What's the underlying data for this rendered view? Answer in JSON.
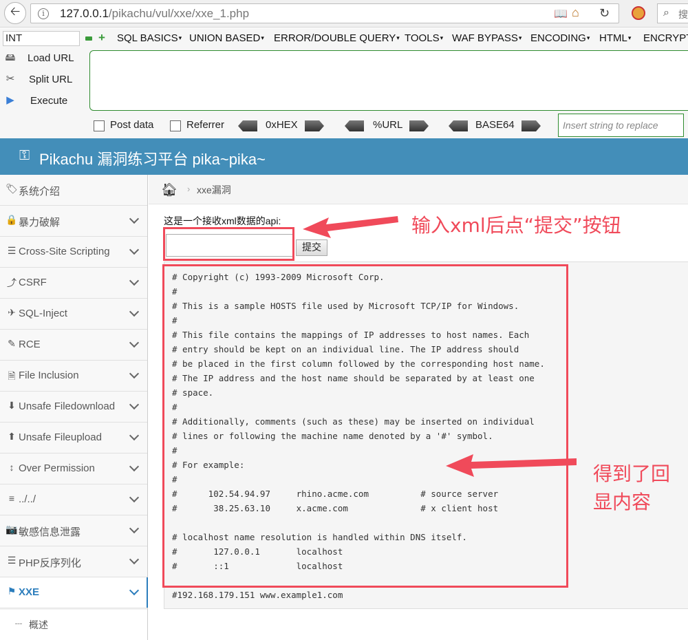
{
  "browser": {
    "url_host": "127.0.0.1",
    "url_path": "/pikachu/vul/xxe/xxe_1.php",
    "search_placeholder": "搜"
  },
  "hackbar": {
    "select_value": "INT",
    "menus": [
      "SQL BASICS",
      "UNION BASED",
      "ERROR/DOUBLE QUERY",
      "TOOLS",
      "WAF BYPASS",
      "ENCODING",
      "HTML",
      "ENCRYPT"
    ],
    "load_url": "Load URL",
    "split_url": "Split URL",
    "execute": "Execute",
    "post_data": "Post data",
    "referrer": "Referrer",
    "hex": "0xHEX",
    "url_enc": "%URL",
    "base64": "BASE64",
    "replace_placeholder": "Insert string to replace"
  },
  "header": {
    "title": "Pikachu 漏洞练习平台 pika~pika~"
  },
  "sidebar": {
    "items": [
      {
        "label": "系统介绍",
        "icon": "tags-icon"
      },
      {
        "label": "暴力破解",
        "icon": "lock-icon"
      },
      {
        "label": "Cross-Site Scripting",
        "icon": "list-icon"
      },
      {
        "label": "CSRF",
        "icon": "share-icon"
      },
      {
        "label": "SQL-Inject",
        "icon": "plane-icon"
      },
      {
        "label": "RCE",
        "icon": "pencil-icon"
      },
      {
        "label": "File Inclusion",
        "icon": "file-icon"
      },
      {
        "label": "Unsafe Filedownload",
        "icon": "download-icon"
      },
      {
        "label": "Unsafe Fileupload",
        "icon": "upload-icon"
      },
      {
        "label": "Over Permission",
        "icon": "text-height-icon"
      },
      {
        "label": "../../",
        "icon": "align-icon"
      },
      {
        "label": "敏感信息泄露",
        "icon": "camera-icon"
      },
      {
        "label": "PHP反序列化",
        "icon": "list-alt-icon"
      },
      {
        "label": "XXE",
        "icon": "flag-icon"
      }
    ],
    "sub_item": "概述"
  },
  "breadcrumb": {
    "item": "xxe漏洞"
  },
  "form": {
    "label": "这是一个接收xml数据的api:",
    "submit": "提交"
  },
  "output": {
    "lines": [
      "# Copyright (c) 1993-2009 Microsoft Corp.",
      "#",
      "# This is a sample HOSTS file used by Microsoft TCP/IP for Windows.",
      "#",
      "# This file contains the mappings of IP addresses to host names. Each",
      "# entry should be kept on an individual line. The IP address should",
      "# be placed in the first column followed by the corresponding host name.",
      "# The IP address and the host name should be separated by at least one",
      "# space.",
      "#",
      "# Additionally, comments (such as these) may be inserted on individual",
      "# lines or following the machine name denoted by a '#' symbol.",
      "#",
      "# For example:",
      "#",
      "#      102.54.94.97     rhino.acme.com          # source server",
      "#       38.25.63.10     x.acme.com              # x client host",
      "",
      "# localhost name resolution is handled within DNS itself.",
      "#       127.0.0.1       localhost",
      "#       ::1             localhost",
      "",
      "#192.168.179.151 www.example1.com"
    ]
  },
  "annotations": {
    "note_input": "输入xml后点“提交”按钮",
    "note_output_line1": "得到了回",
    "note_output_line2": "显内容",
    "color": "#f04a5a"
  },
  "colors": {
    "header_bg": "#438eb9",
    "accent": "#2b7dbc",
    "hackbar_green": "#2e8b2e"
  }
}
